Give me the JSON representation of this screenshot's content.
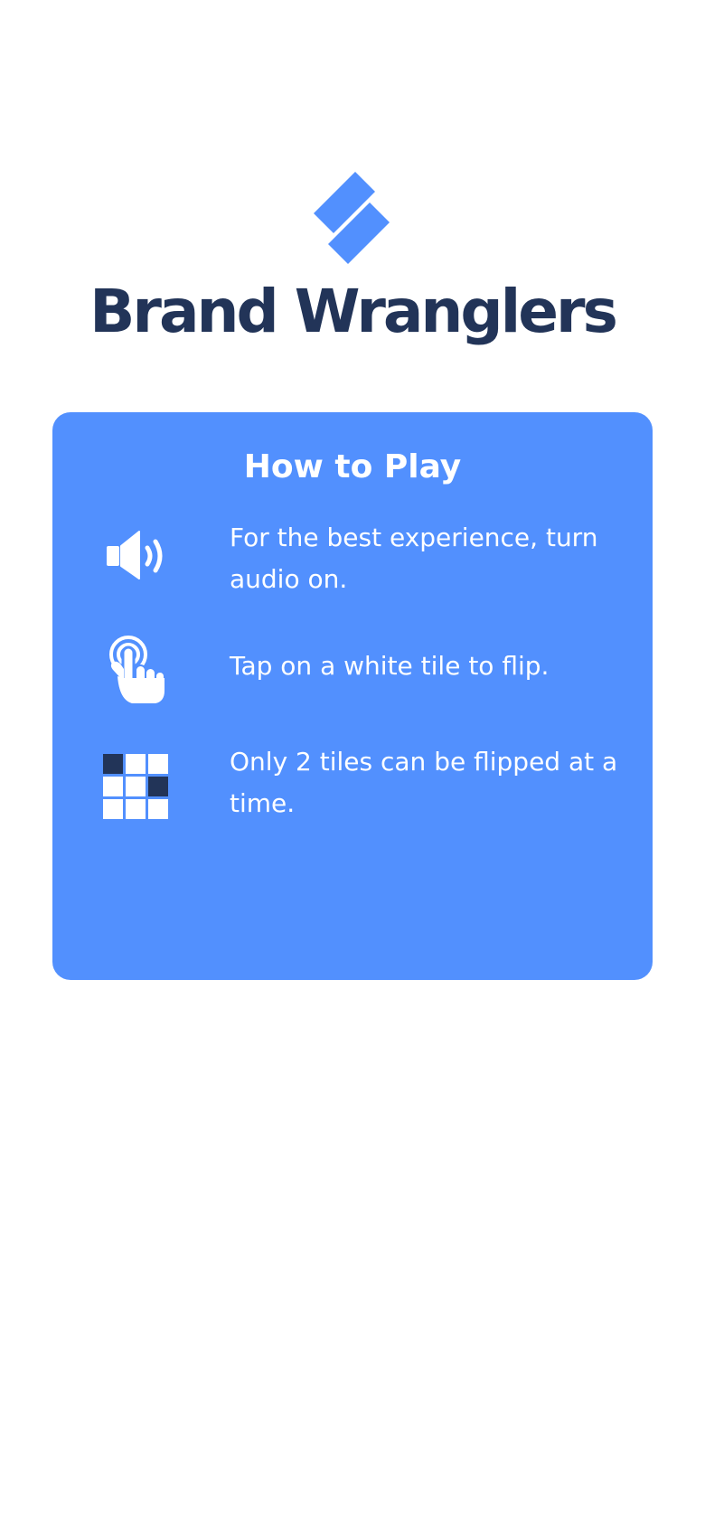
{
  "brand": {
    "logo_icon": "brand-logo-icon",
    "title": "Brand Wranglers"
  },
  "how_to_play": {
    "title": "How to Play",
    "rules": [
      {
        "icon": "speaker-icon",
        "text": "For the best experience, turn audio on."
      },
      {
        "icon": "tap-hand-icon",
        "text": "Tap on a white tile to flip."
      },
      {
        "icon": "tile-grid-icon",
        "text": "Only 2 tiles can be flipped at a time."
      }
    ]
  },
  "colors": {
    "background": "#ffffff",
    "card": "#5290fe",
    "brand_navy": "#223458",
    "logo_blue": "#5290fe",
    "text_on_card": "#ffffff"
  }
}
